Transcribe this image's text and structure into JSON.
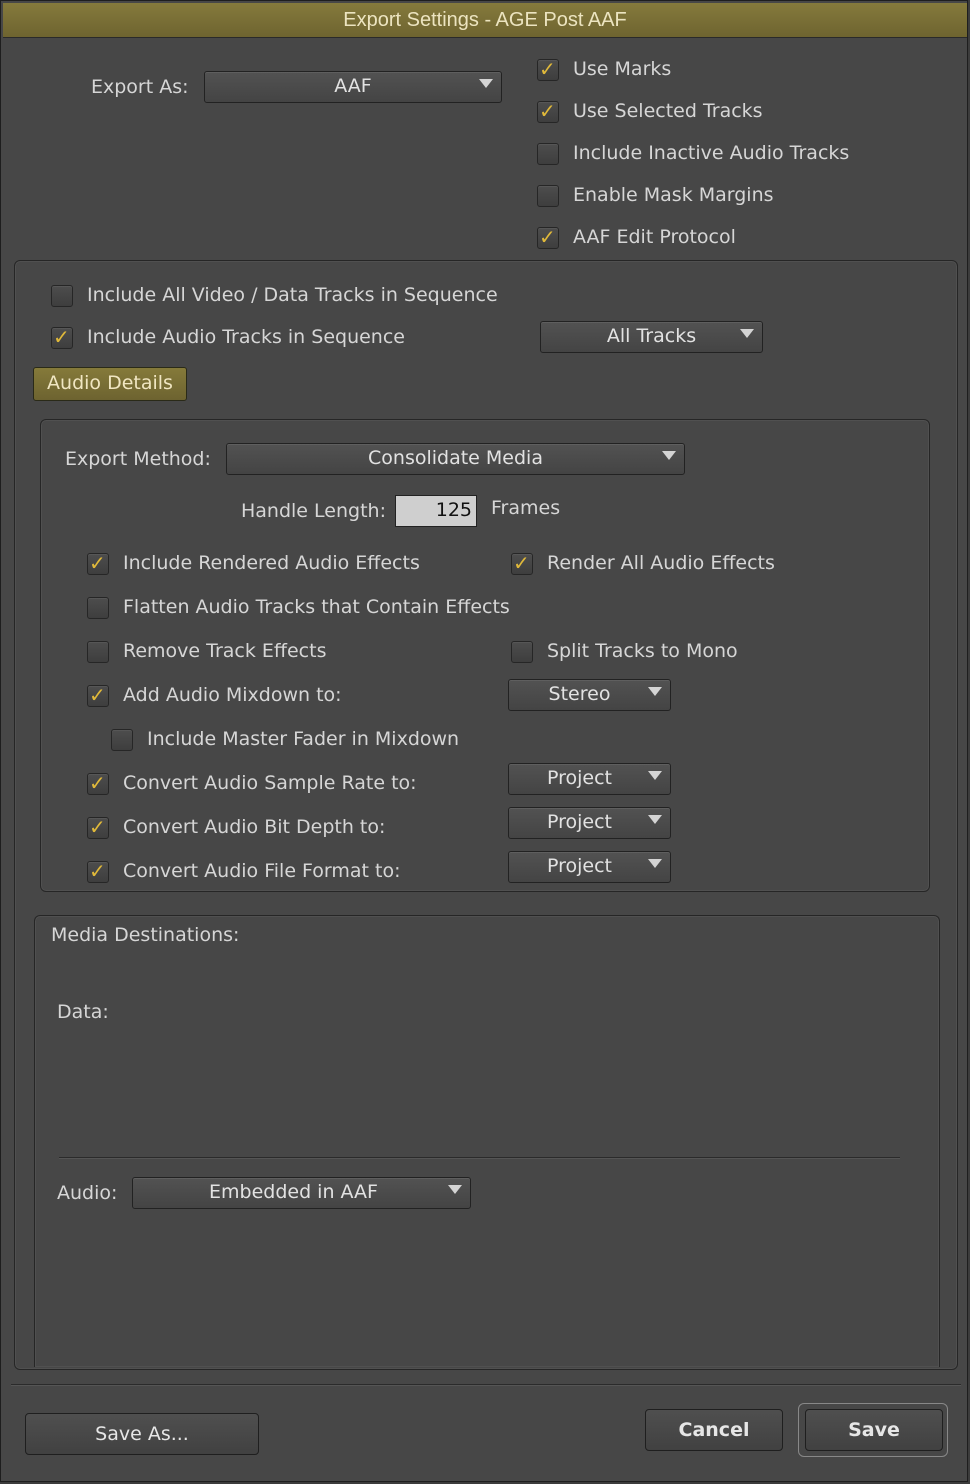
{
  "window": {
    "title": "Export Settings - AGE Post AAF"
  },
  "accent_color": "#e0b93a",
  "title_bar_color": "#7a7036",
  "export_as": {
    "label": "Export As:",
    "value": "AAF"
  },
  "top_options": [
    {
      "label": "Use Marks",
      "checked": true
    },
    {
      "label": "Use Selected Tracks",
      "checked": true
    },
    {
      "label": "Include Inactive Audio Tracks",
      "checked": false
    },
    {
      "label": "Enable Mask Margins",
      "checked": false
    },
    {
      "label": "AAF Edit Protocol",
      "checked": true
    }
  ],
  "sequence": {
    "include_video": {
      "label": "Include All Video / Data Tracks in Sequence",
      "checked": false
    },
    "include_audio": {
      "label": "Include Audio Tracks in Sequence",
      "checked": true
    },
    "tracks_select": "All Tracks",
    "audio_details_button": "Audio Details"
  },
  "audio_details": {
    "export_method_label": "Export Method:",
    "export_method_value": "Consolidate Media",
    "handle_length_label": "Handle Length:",
    "handle_length_value": "125",
    "handle_length_unit": "Frames",
    "include_rendered": {
      "label": "Include Rendered Audio Effects",
      "checked": true
    },
    "render_all": {
      "label": "Render All Audio Effects",
      "checked": true
    },
    "flatten": {
      "label": "Flatten Audio Tracks that Contain Effects",
      "checked": false
    },
    "remove_track_effects": {
      "label": "Remove Track Effects",
      "checked": false
    },
    "split_mono": {
      "label": "Split Tracks to Mono",
      "checked": false
    },
    "add_mixdown": {
      "label": "Add Audio Mixdown to:",
      "checked": true,
      "value": "Stereo"
    },
    "include_master_fader": {
      "label": "Include Master Fader in Mixdown",
      "checked": false
    },
    "convert_sample_rate": {
      "label": "Convert Audio Sample Rate to:",
      "checked": true,
      "value": "Project"
    },
    "convert_bit_depth": {
      "label": "Convert Audio Bit Depth to:",
      "checked": true,
      "value": "Project"
    },
    "convert_file_format": {
      "label": "Convert Audio File Format to:",
      "checked": true,
      "value": "Project"
    }
  },
  "media_destinations": {
    "title": "Media Destinations:",
    "data_label": "Data:",
    "audio_label": "Audio:",
    "audio_value": "Embedded in AAF"
  },
  "buttons": {
    "save_as": "Save As...",
    "cancel": "Cancel",
    "save": "Save"
  }
}
